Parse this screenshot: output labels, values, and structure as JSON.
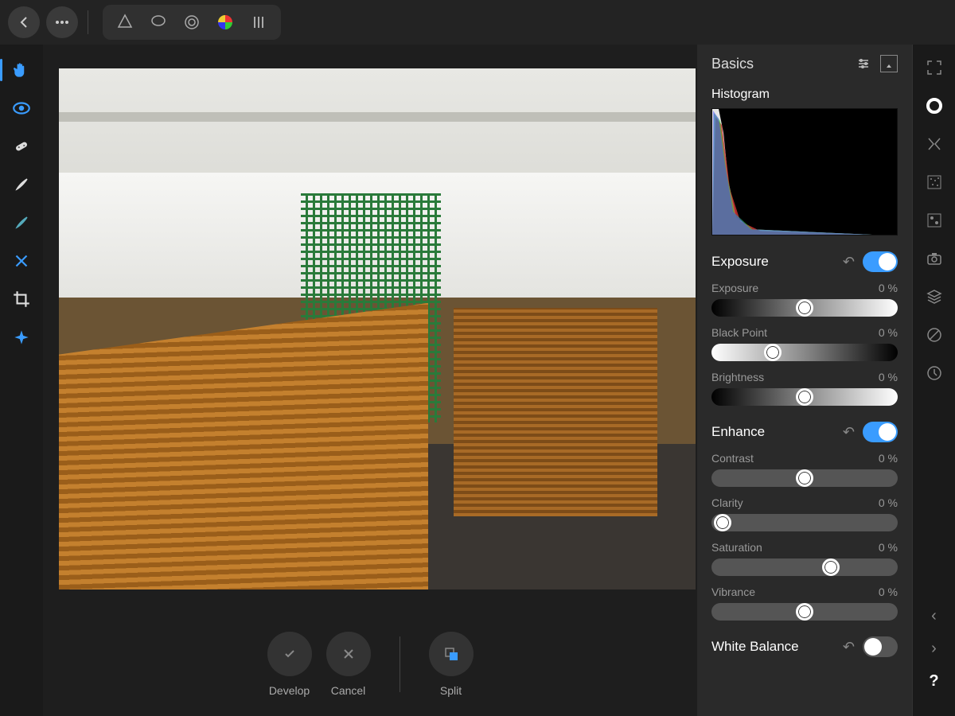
{
  "topbar": {
    "back": "back",
    "menu": "menu",
    "tools": [
      "affinity-logo",
      "lasso",
      "radial",
      "color-wheel",
      "column"
    ]
  },
  "leftTools": [
    {
      "name": "hand-tool",
      "active": true
    },
    {
      "name": "view-tool",
      "active": false
    },
    {
      "name": "heal-tool",
      "active": false
    },
    {
      "name": "brush-tool",
      "active": false
    },
    {
      "name": "erase-tool",
      "active": false
    },
    {
      "name": "clone-tool",
      "active": false
    },
    {
      "name": "crop-tool",
      "active": false
    },
    {
      "name": "sparkle-tool",
      "active": false
    }
  ],
  "actions": {
    "develop": "Develop",
    "cancel": "Cancel",
    "split": "Split"
  },
  "panel": {
    "title": "Basics",
    "histogram": "Histogram",
    "groups": [
      {
        "title": "Exposure",
        "enabled": true,
        "sliders": [
          {
            "label": "Exposure",
            "value": "0 %",
            "pos": 50,
            "grad": "grad-exp"
          },
          {
            "label": "Black Point",
            "value": "0 %",
            "pos": 33,
            "grad": "grad-bp"
          },
          {
            "label": "Brightness",
            "value": "0 %",
            "pos": 50,
            "grad": "grad-exp"
          }
        ]
      },
      {
        "title": "Enhance",
        "enabled": true,
        "sliders": [
          {
            "label": "Contrast",
            "value": "0 %",
            "pos": 50,
            "grad": ""
          },
          {
            "label": "Clarity",
            "value": "0 %",
            "pos": 6,
            "grad": ""
          },
          {
            "label": "Saturation",
            "value": "0 %",
            "pos": 64,
            "grad": ""
          },
          {
            "label": "Vibrance",
            "value": "0 %",
            "pos": 50,
            "grad": ""
          }
        ]
      },
      {
        "title": "White Balance",
        "enabled": false,
        "sliders": []
      }
    ]
  },
  "rightStrip": [
    {
      "name": "fullscreen-icon"
    },
    {
      "name": "ring-icon",
      "active": true
    },
    {
      "name": "pinch-icon"
    },
    {
      "name": "noise-icon"
    },
    {
      "name": "channels-icon"
    },
    {
      "name": "camera-icon"
    },
    {
      "name": "layers-icon"
    },
    {
      "name": "circle-slash-icon"
    },
    {
      "name": "clock-icon"
    }
  ]
}
